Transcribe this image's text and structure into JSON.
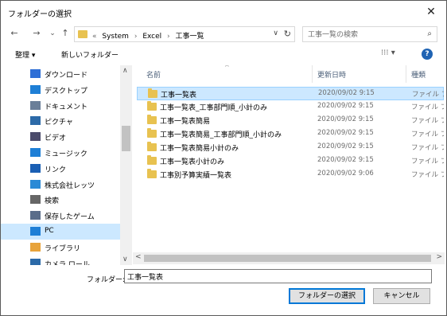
{
  "window": {
    "title": "フォルダーの選択",
    "close": "✕"
  },
  "nav": {
    "back": "←",
    "forward": "→",
    "recent": "⌄",
    "up": "↑",
    "breadcrumbs": [
      "«",
      "System",
      "›",
      "Excel",
      "›",
      "工事一覧"
    ],
    "dropdown": "∨",
    "refresh": "↻",
    "search_placeholder": "工事一覧の検索",
    "search_icon": "⌕"
  },
  "toolbar": {
    "organize": "整理 ▾",
    "new_folder": "新しいフォルダー",
    "view": "⁝⁝⁝ ▾",
    "help": "?"
  },
  "sidebar": {
    "items": [
      {
        "label": "ダウンロード",
        "icon": "download-icon",
        "color": "#2f6fd6"
      },
      {
        "label": "デスクトップ",
        "icon": "desktop-icon",
        "color": "#1e7fd6"
      },
      {
        "label": "ドキュメント",
        "icon": "document-icon",
        "color": "#6a7f99"
      },
      {
        "label": "ピクチャ",
        "icon": "pictures-icon",
        "color": "#2c6aa8"
      },
      {
        "label": "ビデオ",
        "icon": "video-icon",
        "color": "#4b4b6b"
      },
      {
        "label": "ミュージック",
        "icon": "music-icon",
        "color": "#1e7fd6"
      },
      {
        "label": "リンク",
        "icon": "link-icon",
        "color": "#1a5fb4"
      },
      {
        "label": "株式会社レッツ",
        "icon": "building-icon",
        "color": "#2a8ad6"
      },
      {
        "label": "検索",
        "icon": "search-icon",
        "color": "#666"
      },
      {
        "label": "保存したゲーム",
        "icon": "games-icon",
        "color": "#5a6d8a"
      },
      {
        "label": "PC",
        "icon": "pc-icon",
        "color": "#1e7fd6",
        "selected": true
      },
      {
        "label": "ライブラリ",
        "icon": "library-icon",
        "color": "#e8a33a"
      },
      {
        "label": "カメラ ロール",
        "icon": "camera-roll-icon",
        "color": "#2c6aa8"
      }
    ],
    "scroll_up": "∧",
    "scroll_down": "∨"
  },
  "files": {
    "headers": {
      "name": "名前",
      "date": "更新日時",
      "type": "種類"
    },
    "sort_indicator": "^",
    "rows": [
      {
        "name": "工事一覧表",
        "date": "2020/09/02 9:15",
        "type": "ファイル フォ",
        "selected": true
      },
      {
        "name": "工事一覧表_工事部門順_小計のみ",
        "date": "2020/09/02 9:15",
        "type": "ファイル フォ"
      },
      {
        "name": "工事一覧表簡易",
        "date": "2020/09/02 9:15",
        "type": "ファイル フォ"
      },
      {
        "name": "工事一覧表簡易_工事部門順_小計のみ",
        "date": "2020/09/02 9:15",
        "type": "ファイル フォ"
      },
      {
        "name": "工事一覧表簡易小計のみ",
        "date": "2020/09/02 9:15",
        "type": "ファイル フォ"
      },
      {
        "name": "工事一覧表小計のみ",
        "date": "2020/09/02 9:15",
        "type": "ファイル フォ"
      },
      {
        "name": "工事別予算実績一覧表",
        "date": "2020/09/02 9:06",
        "type": "ファイル フォ"
      }
    ],
    "hscroll_left": "<",
    "hscroll_right": ">"
  },
  "footer": {
    "folder_label": "フォルダー:",
    "folder_value": "工事一覧表",
    "select_button": "フォルダーの選択",
    "cancel_button": "キャンセル"
  }
}
